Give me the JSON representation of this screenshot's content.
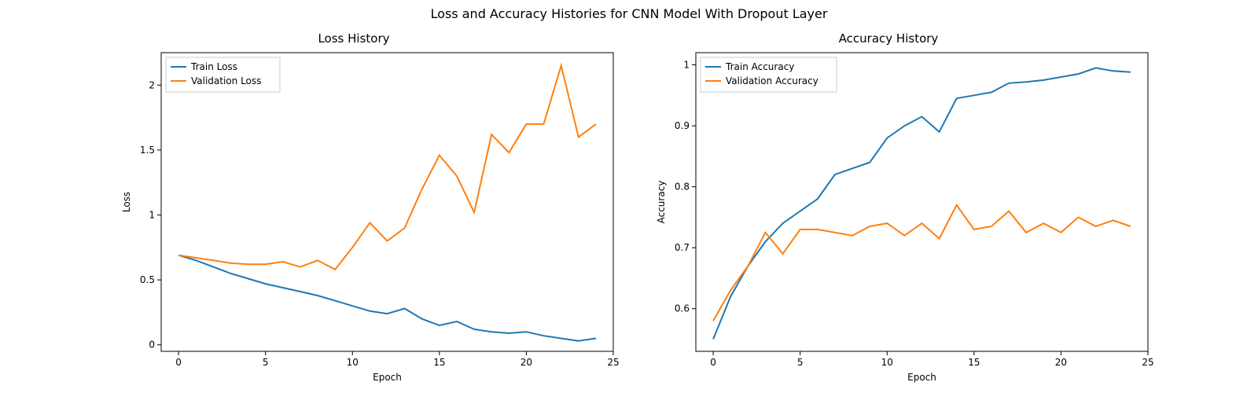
{
  "suptitle": "Loss and Accuracy Histories for CNN Model With Dropout Layer",
  "colors": {
    "train": "#1f77b4",
    "val": "#ff7f0e"
  },
  "chart_data": [
    {
      "type": "line",
      "title": "Loss History",
      "xlabel": "Epoch",
      "ylabel": "Loss",
      "xlim": [
        -1,
        25
      ],
      "ylim": [
        -0.05,
        2.25
      ],
      "xticks": [
        0,
        5,
        10,
        15,
        20,
        25
      ],
      "yticks": [
        0.0,
        0.5,
        1.0,
        1.5,
        2.0
      ],
      "legend_pos": "upper-left",
      "x": [
        0,
        1,
        2,
        3,
        4,
        5,
        6,
        7,
        8,
        9,
        10,
        11,
        12,
        13,
        14,
        15,
        16,
        17,
        18,
        19,
        20,
        21,
        22,
        23,
        24
      ],
      "series": [
        {
          "name": "Train Loss",
          "color": "train",
          "values": [
            0.69,
            0.65,
            0.6,
            0.55,
            0.51,
            0.47,
            0.44,
            0.41,
            0.38,
            0.34,
            0.3,
            0.26,
            0.24,
            0.28,
            0.2,
            0.15,
            0.18,
            0.12,
            0.1,
            0.09,
            0.1,
            0.07,
            0.05,
            0.03,
            0.05
          ]
        },
        {
          "name": "Validation Loss",
          "color": "val",
          "values": [
            0.69,
            0.67,
            0.65,
            0.63,
            0.62,
            0.62,
            0.64,
            0.6,
            0.65,
            0.58,
            0.75,
            0.94,
            0.8,
            0.9,
            1.2,
            1.46,
            1.3,
            1.02,
            1.62,
            1.48,
            1.7,
            1.7,
            2.15,
            1.6,
            1.7
          ]
        }
      ]
    },
    {
      "type": "line",
      "title": "Accuracy History",
      "xlabel": "Epoch",
      "ylabel": "Accuracy",
      "xlim": [
        -1,
        25
      ],
      "ylim": [
        0.53,
        1.02
      ],
      "xticks": [
        0,
        5,
        10,
        15,
        20,
        25
      ],
      "yticks": [
        0.6,
        0.7,
        0.8,
        0.9,
        1.0
      ],
      "legend_pos": "upper-left",
      "x": [
        0,
        1,
        2,
        3,
        4,
        5,
        6,
        7,
        8,
        9,
        10,
        11,
        12,
        13,
        14,
        15,
        16,
        17,
        18,
        19,
        20,
        21,
        22,
        23,
        24
      ],
      "series": [
        {
          "name": "Train Accuracy",
          "color": "train",
          "values": [
            0.55,
            0.62,
            0.67,
            0.71,
            0.74,
            0.76,
            0.78,
            0.82,
            0.83,
            0.84,
            0.88,
            0.9,
            0.915,
            0.89,
            0.945,
            0.95,
            0.955,
            0.97,
            0.972,
            0.975,
            0.98,
            0.985,
            0.995,
            0.99,
            0.988
          ]
        },
        {
          "name": "Validation Accuracy",
          "color": "val",
          "values": [
            0.58,
            0.63,
            0.67,
            0.725,
            0.69,
            0.73,
            0.73,
            0.725,
            0.72,
            0.735,
            0.74,
            0.72,
            0.74,
            0.715,
            0.77,
            0.73,
            0.735,
            0.76,
            0.725,
            0.74,
            0.725,
            0.75,
            0.735,
            0.745,
            0.735
          ]
        }
      ]
    }
  ]
}
